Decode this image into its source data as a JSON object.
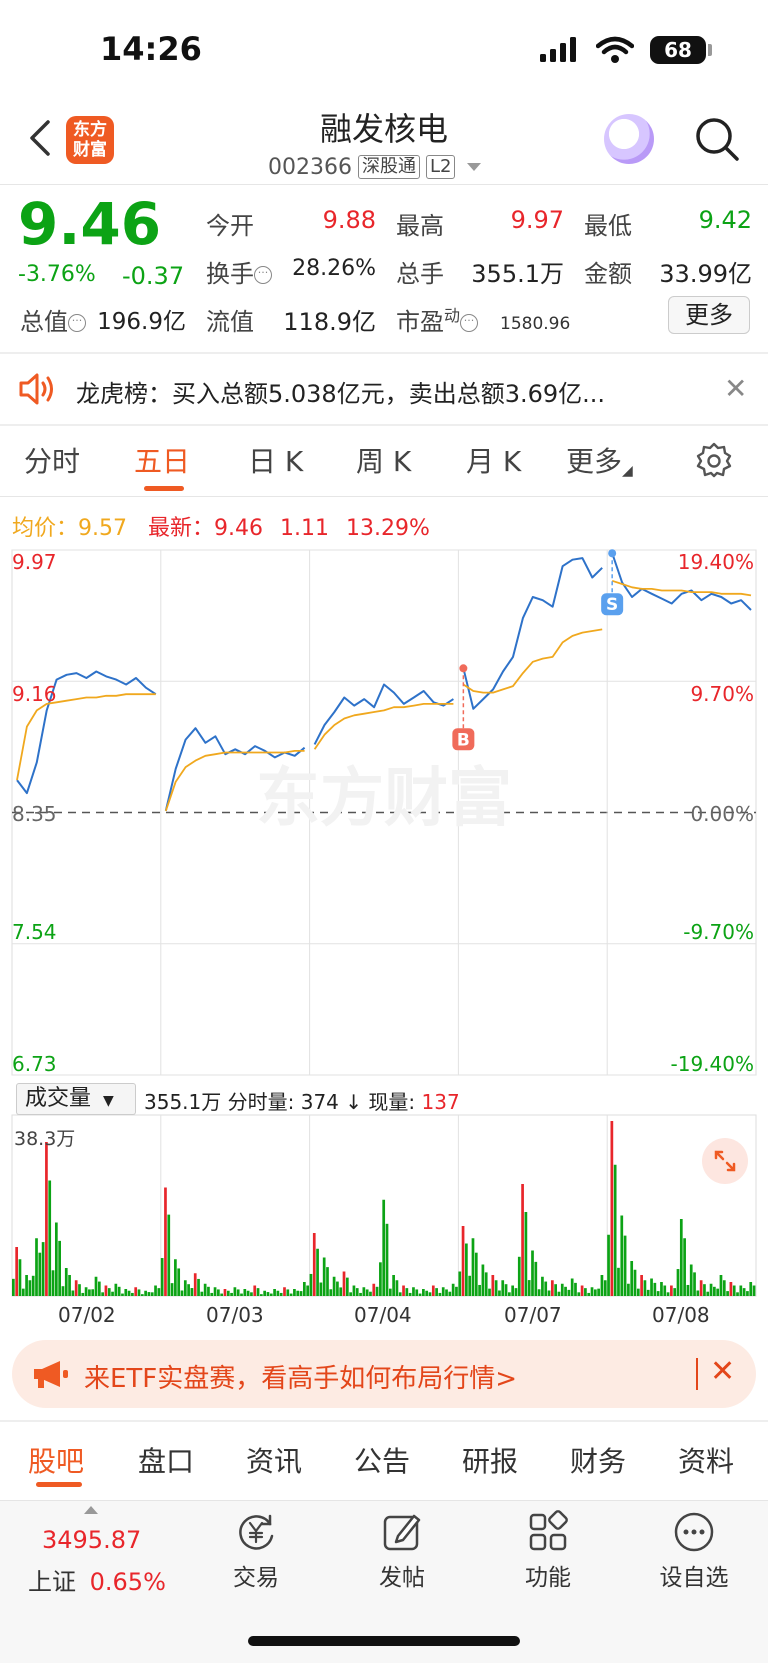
{
  "status_bar": {
    "time": "14:26",
    "battery": "68"
  },
  "header": {
    "logo_text_1": "东方",
    "logo_text_2": "财富",
    "title": "融发核电",
    "code": "002366",
    "tag1": "深股通",
    "tag2": "L2"
  },
  "quote": {
    "price": "9.46",
    "change_pct": "-3.76%",
    "change": "-0.37",
    "fields": {
      "open_label": "今开",
      "open": "9.88",
      "high_label": "最高",
      "high": "9.97",
      "low_label": "最低",
      "low": "9.42",
      "turnover_label": "换手",
      "turnover": "28.26%",
      "volume_label": "总手",
      "volume": "355.1万",
      "amount_label": "金额",
      "amount": "33.99亿",
      "mktcap_label": "总值",
      "mktcap": "196.9亿",
      "float_label": "流值",
      "float": "118.9亿",
      "pe_label": "市盈",
      "pe_sup": "动",
      "pe": "1580.96"
    },
    "more_label": "更多"
  },
  "notice": {
    "text": "龙虎榜：买入总额5.038亿元，卖出总额3.69亿..."
  },
  "chart_tabs": [
    "分时",
    "五日",
    "日 K",
    "周 K",
    "月 K",
    "更多"
  ],
  "active_chart_tab": "五日",
  "info_line": {
    "avg_label": "均价：",
    "avg": "9.57",
    "latest_label": "最新：",
    "latest": "9.46",
    "change": "1.11",
    "change_pct": "13.29%"
  },
  "chart_data": {
    "type": "line",
    "title": "",
    "xlabel": "",
    "ylabel": "",
    "x": [
      "07/02",
      "07/03",
      "07/04",
      "07/07",
      "07/08"
    ],
    "y_ticks_left": [
      "9.97",
      "9.16",
      "8.35",
      "7.54",
      "6.73"
    ],
    "y_ticks_right": [
      "19.40%",
      "9.70%",
      "0.00%",
      "-9.70%",
      "-19.40%"
    ],
    "ylim": [
      6.73,
      9.97
    ],
    "prev_close": 8.35,
    "series": [
      {
        "color": "#2e72c9",
        "values": [
          8.55,
          8.47,
          8.66,
          8.98,
          9.17,
          9.2,
          9.21,
          9.18,
          9.22,
          9.19,
          9.17,
          9.14,
          9.18,
          9.12,
          9.08,
          8.36,
          8.62,
          8.8,
          8.87,
          8.78,
          8.82,
          8.71,
          8.74,
          8.71,
          8.76,
          8.73,
          8.69,
          8.72,
          8.7,
          8.75,
          8.77,
          8.89,
          8.97,
          9.06,
          9.01,
          9.05,
          9.0,
          9.14,
          9.09,
          9.02,
          9.06,
          9.1,
          9.03,
          9.01,
          9.05,
          9.24,
          8.99,
          9.05,
          9.11,
          9.22,
          9.31,
          9.55,
          9.68,
          9.66,
          9.62,
          9.87,
          9.91,
          9.92,
          9.8,
          9.86,
          9.95,
          9.77,
          9.68,
          9.73,
          9.7,
          9.67,
          9.64,
          9.7,
          9.72,
          9.66,
          9.7,
          9.68,
          9.64,
          9.66,
          9.6
        ]
      },
      {
        "color": "#f0a81e",
        "values": [
          8.55,
          8.88,
          8.98,
          9.02,
          9.03,
          9.04,
          9.05,
          9.06,
          9.06,
          9.07,
          9.07,
          9.08,
          9.08,
          9.08,
          9.08,
          8.36,
          8.54,
          8.63,
          8.67,
          8.7,
          8.71,
          8.72,
          8.72,
          8.72,
          8.72,
          8.72,
          8.72,
          8.72,
          8.73,
          8.73,
          8.74,
          8.83,
          8.89,
          8.93,
          8.95,
          8.96,
          8.97,
          8.98,
          9.0,
          9.0,
          9.01,
          9.02,
          9.02,
          9.02,
          9.02,
          9.14,
          9.1,
          9.09,
          9.09,
          9.11,
          9.13,
          9.21,
          9.28,
          9.3,
          9.31,
          9.4,
          9.44,
          9.46,
          9.47,
          9.48,
          9.78,
          9.76,
          9.74,
          9.73,
          9.73,
          9.72,
          9.72,
          9.72,
          9.71,
          9.71,
          9.71,
          9.7,
          9.7,
          9.7,
          9.69
        ]
      }
    ],
    "markers": [
      {
        "label": "B",
        "index": 45,
        "value": 9.24,
        "color": "#f06b5a"
      },
      {
        "label": "S",
        "index": 60,
        "value": 9.95,
        "color": "#5aa0ee"
      }
    ]
  },
  "volume": {
    "selector": "成交量",
    "total": "355.1万",
    "min_label": "分时量:",
    "min_value": "374",
    "arrow": "↓",
    "now_label": "现量:",
    "now_value": "137",
    "max": "38.3万",
    "bars": [
      0.28,
      0.12,
      0.33,
      0.88,
      0.42,
      0.16,
      0.09,
      0.05,
      0.11,
      0.06,
      0.07,
      0.04,
      0.05,
      0.03,
      0.06,
      0.62,
      0.21,
      0.09,
      0.13,
      0.07,
      0.05,
      0.04,
      0.05,
      0.04,
      0.06,
      0.03,
      0.04,
      0.05,
      0.04,
      0.08,
      0.36,
      0.22,
      0.11,
      0.14,
      0.06,
      0.05,
      0.07,
      0.55,
      0.12,
      0.06,
      0.05,
      0.04,
      0.06,
      0.05,
      0.07,
      0.4,
      0.33,
      0.18,
      0.12,
      0.09,
      0.06,
      0.64,
      0.26,
      0.11,
      0.09,
      0.07,
      0.1,
      0.06,
      0.05,
      0.12,
      1.0,
      0.46,
      0.2,
      0.12,
      0.1,
      0.08,
      0.06,
      0.44,
      0.18,
      0.09,
      0.07,
      0.12,
      0.08,
      0.06,
      0.08
    ],
    "bar_colors": [
      "#0ca315",
      "#e8262b"
    ]
  },
  "x_dates": [
    "07/02",
    "07/03",
    "07/04",
    "07/07",
    "07/08"
  ],
  "promo": {
    "text": "来ETF实盘赛，看高手如何布局行情>"
  },
  "bottom_tabs": [
    "股吧",
    "盘口",
    "资讯",
    "公告",
    "研报",
    "财务",
    "资料"
  ],
  "toolbar": {
    "index_value": "3495.87",
    "index_name": "上证",
    "index_pct": "0.65%",
    "items": [
      {
        "label": "交易",
        "icon": "yen-exchange-icon"
      },
      {
        "label": "发帖",
        "icon": "edit-post-icon"
      },
      {
        "label": "功能",
        "icon": "grid-apps-icon"
      },
      {
        "label": "设自选",
        "icon": "more-dots-icon"
      }
    ]
  }
}
